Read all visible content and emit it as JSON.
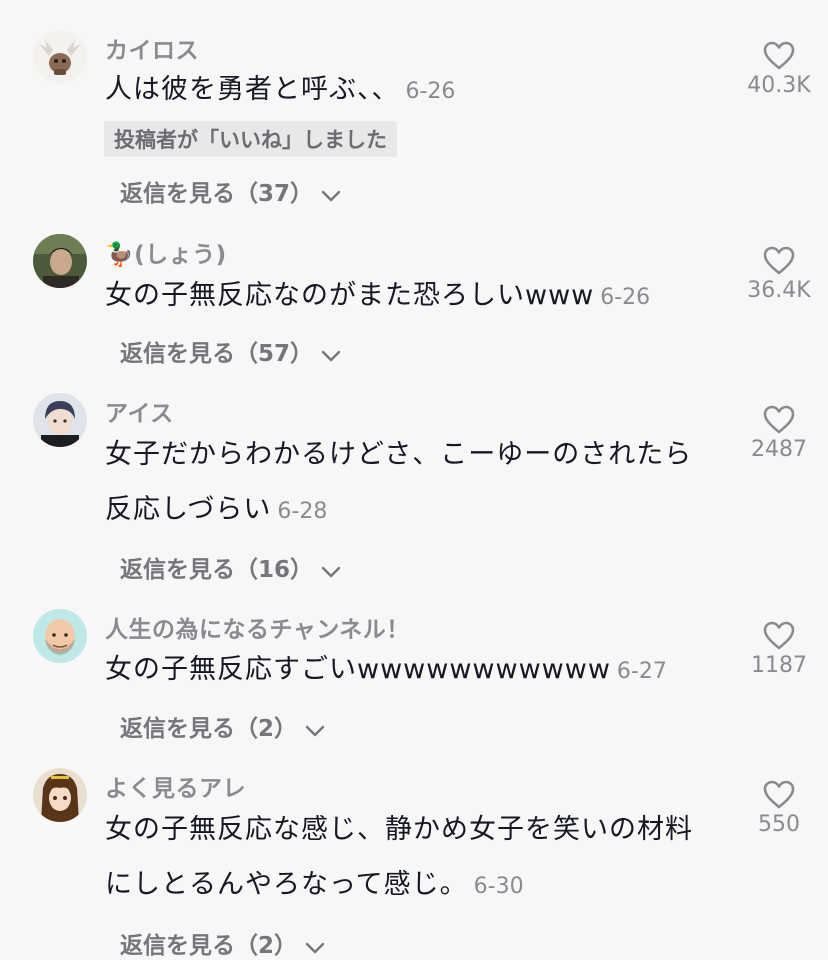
{
  "comments": [
    {
      "username": "カイロス",
      "text": "人は彼を勇者と呼ぶ、、",
      "date": "6-26",
      "badge": "投稿者が「いいね」しました",
      "replies_label": "返信を見る（37）",
      "likes": "40.3K",
      "avatar": "monster-avatar"
    },
    {
      "username": "🦆(しょう)",
      "text": "女の子無反応なのがまた恐ろしいwww",
      "date": "6-26",
      "replies_label": "返信を見る（57）",
      "likes": "36.4K",
      "avatar": "person-photo-avatar"
    },
    {
      "username": "アイス",
      "text": "女子だからわかるけどさ、こーゆーのされたら反応しづらい",
      "date": "6-28",
      "replies_label": "返信を見る（16）",
      "likes": "2487",
      "avatar": "anime-boy-avatar"
    },
    {
      "username": "人生の為になるチャンネル！",
      "text": "女の子無反応すごいwwwwwwwwwww",
      "date": "6-27",
      "replies_label": "返信を見る（2）",
      "likes": "1187",
      "avatar": "bald-man-avatar"
    },
    {
      "username": "よく見るアレ",
      "text": "女の子無反応な感じ、静かめ女子を笑いの材料にしとるんやろなって感じ。",
      "date": "6-30",
      "replies_label": "返信を見る（2）",
      "likes": "550",
      "avatar": "anime-girl-avatar"
    }
  ],
  "icons": {
    "like": "heart-outline-icon",
    "expand": "chevron-down-icon"
  },
  "colors": {
    "background": "#f7f7f7",
    "text": "#161823",
    "secondary": "#8a8b91",
    "badge_bg": "#e8e8e9"
  }
}
